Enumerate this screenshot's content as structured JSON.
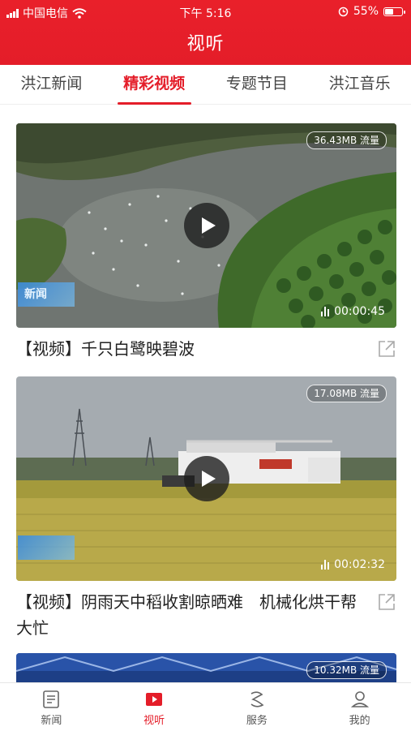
{
  "status_bar": {
    "carrier": "中国电信",
    "time": "下午 5:16",
    "battery": "55%",
    "battery_level": 0.55,
    "icons": [
      "signal-icon",
      "wifi-icon",
      "alarm-icon",
      "battery-icon"
    ]
  },
  "header": {
    "title": "视听"
  },
  "tabs": [
    {
      "label": "洪江新闻",
      "active": false
    },
    {
      "label": "精彩视频",
      "active": true
    },
    {
      "label": "专题节目",
      "active": false
    },
    {
      "label": "洪江音乐",
      "active": false
    }
  ],
  "videos": [
    {
      "traffic": "36.43MB 流量",
      "duration": "00:00:45",
      "title": "【视频】千只白鹭映碧波"
    },
    {
      "traffic": "17.08MB 流量",
      "duration": "00:02:32",
      "title": "【视频】阴雨天中稻收割晾晒难　机械化烘干帮大忙"
    },
    {
      "traffic": "10.32MB 流量"
    }
  ],
  "bottom_nav": [
    {
      "label": "新闻",
      "icon": "newspaper-icon",
      "active": false
    },
    {
      "label": "视听",
      "icon": "video-icon",
      "active": true
    },
    {
      "label": "服务",
      "icon": "service-icon",
      "active": false
    },
    {
      "label": "我的",
      "icon": "profile-icon",
      "active": false
    }
  ],
  "colors": {
    "brand_red": "#e41d29",
    "text": "#222222",
    "inactive": "#555555"
  }
}
